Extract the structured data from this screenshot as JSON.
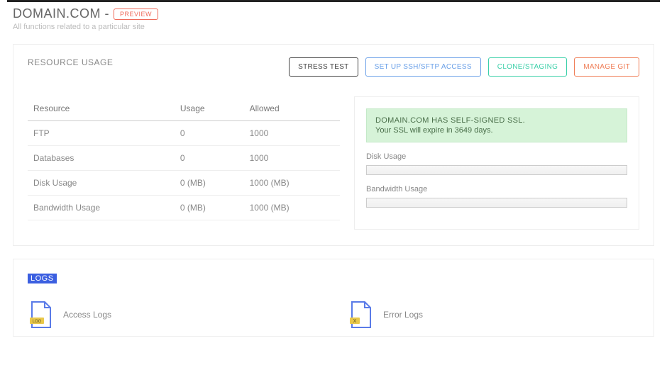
{
  "header": {
    "title": "DOMAIN.COM -",
    "preview_label": "PREVIEW",
    "subtitle": "All functions related to a particular site"
  },
  "resource_panel": {
    "title": "RESOURCE USAGE",
    "buttons": {
      "stress": "STRESS TEST",
      "ssh": "SET UP SSH/SFTP ACCESS",
      "clone": "CLONE/STAGING",
      "git": "MANAGE GIT"
    },
    "table": {
      "cols": {
        "resource": "Resource",
        "usage": "Usage",
        "allowed": "Allowed"
      },
      "rows": [
        {
          "resource": "FTP",
          "usage": "0",
          "allowed": "1000"
        },
        {
          "resource": "Databases",
          "usage": "0",
          "allowed": "1000"
        },
        {
          "resource": "Disk Usage",
          "usage": "0 (MB)",
          "allowed": "1000 (MB)"
        },
        {
          "resource": "Bandwidth Usage",
          "usage": "0 (MB)",
          "allowed": "1000 (MB)"
        }
      ]
    },
    "ssl": {
      "line1": "DOMAIN.COM HAS SELF-SIGNED SSL.",
      "line2": "Your SSL will expire in 3649 days."
    },
    "disk_label": "Disk Usage",
    "bw_label": "Bandwidth Usage"
  },
  "logs": {
    "title": "LOGS",
    "access": "Access Logs",
    "error": "Error Logs",
    "access_tag": "LOG",
    "error_tag": "X"
  }
}
